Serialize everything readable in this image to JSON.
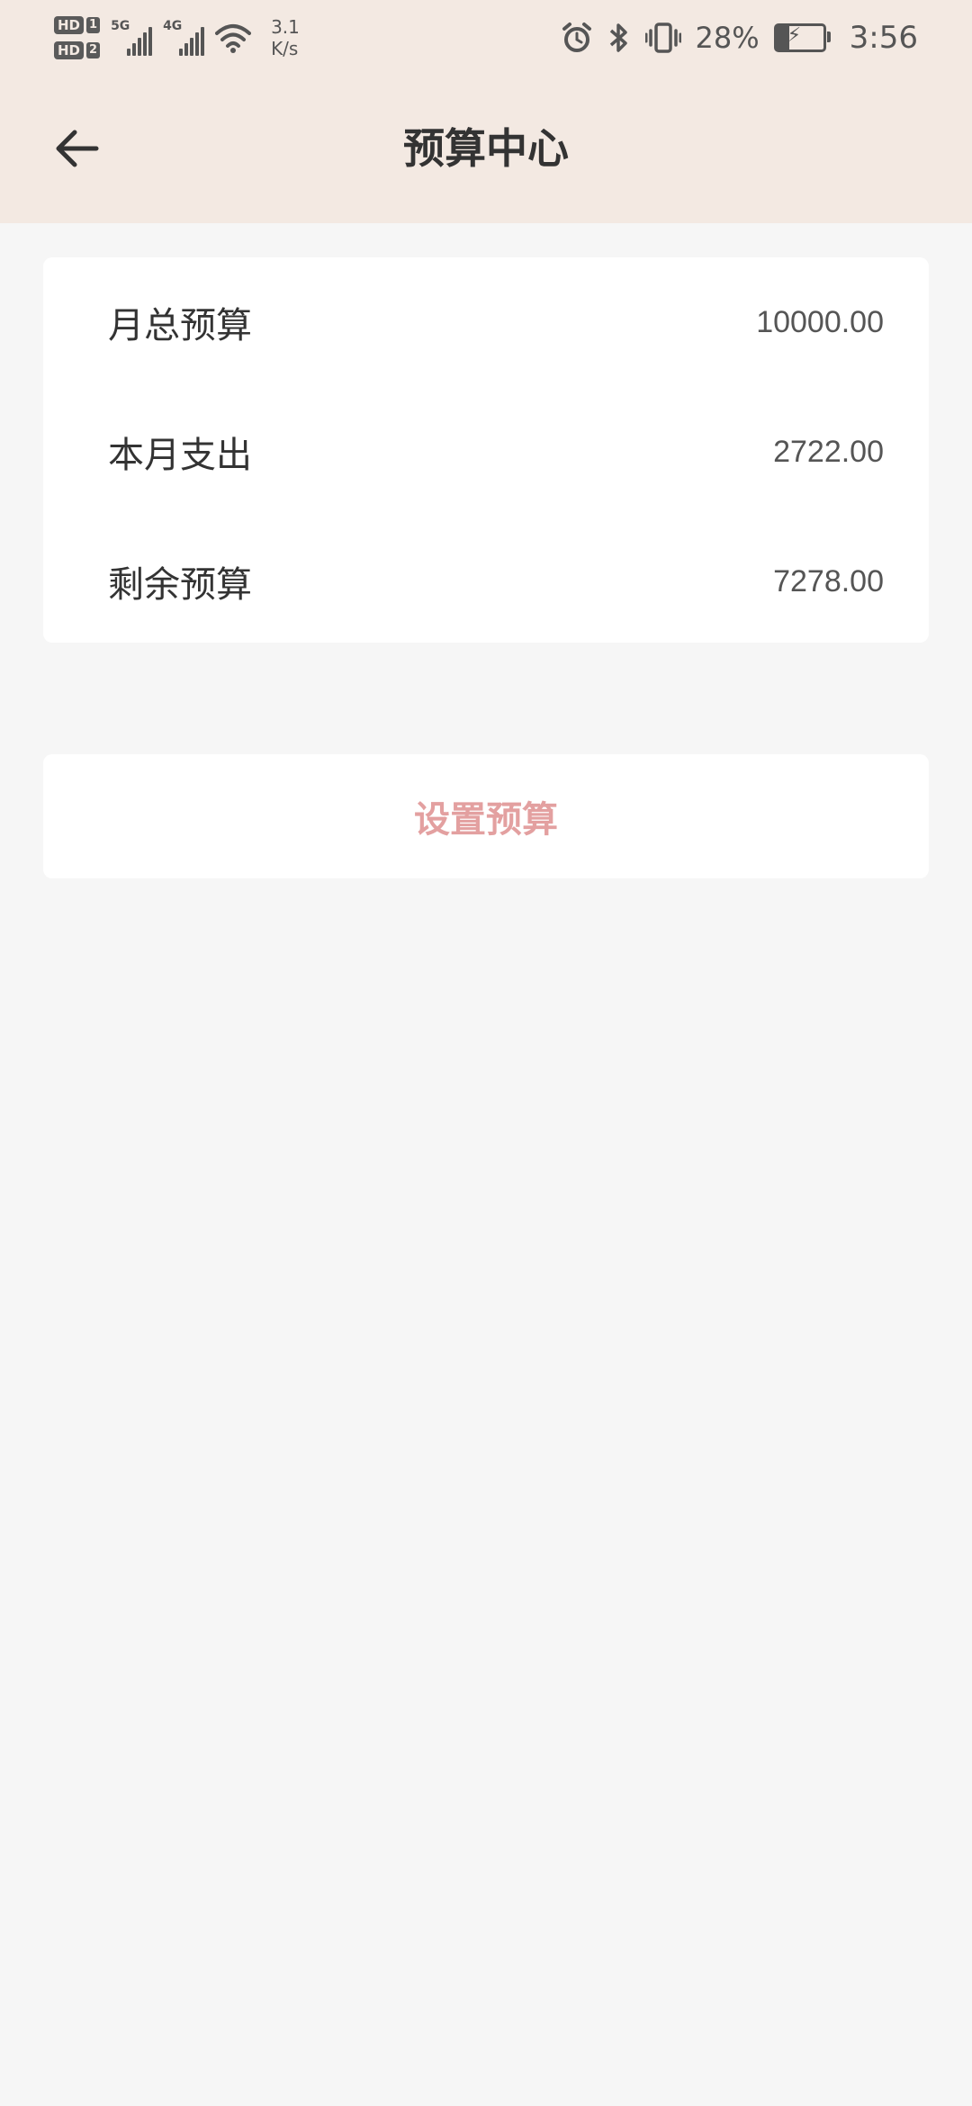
{
  "status_bar": {
    "hd1": "HD",
    "hd1_num": "1",
    "hd2": "HD",
    "hd2_num": "2",
    "signal1_gen": "5G",
    "signal2_gen": "4G",
    "speed_value": "3.1",
    "speed_unit": "K/s",
    "battery_pct": "28%",
    "time": "3:56",
    "icons": [
      "alarm-icon",
      "bluetooth-icon",
      "vibrate-icon",
      "battery-charging-icon",
      "wifi-icon",
      "signal-icon"
    ]
  },
  "header": {
    "title": "预算中心",
    "background": "#f3e9e2"
  },
  "summary": {
    "rows": [
      {
        "label": "月总预算",
        "value": "10000.00"
      },
      {
        "label": "本月支出",
        "value": "2722.00"
      },
      {
        "label": "剩余预算",
        "value": "7278.00"
      }
    ]
  },
  "actions": {
    "set_budget_label": "设置预算",
    "accent_color": "#e3a0a0"
  }
}
